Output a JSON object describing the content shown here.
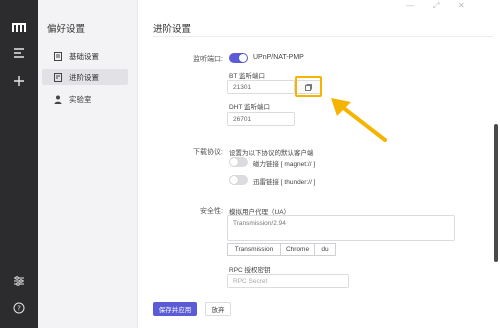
{
  "rail": {
    "logo_icon": "m-logo-icon",
    "items": [
      {
        "name": "menu-icon"
      },
      {
        "name": "plus-icon"
      }
    ],
    "bottom": [
      {
        "name": "sliders-icon"
      },
      {
        "name": "help-icon"
      }
    ]
  },
  "sidebar": {
    "title": "偏好设置",
    "items": [
      {
        "label": "基础设置",
        "icon": "basic-settings-icon"
      },
      {
        "label": "进阶设置",
        "icon": "advanced-settings-icon",
        "active": true
      },
      {
        "label": "实验室",
        "icon": "lab-icon"
      }
    ]
  },
  "main": {
    "title": "进阶设置",
    "listen_port": {
      "label": "监听端口:",
      "toggle_label": "UPnP/NAT-PMP",
      "toggle_on": true,
      "bt_label": "BT 监听端口",
      "bt_value": "21301",
      "dht_label": "DHT 监听端口",
      "dht_value": "26701"
    },
    "protocol": {
      "label": "下载协议:",
      "description": "设置为以下协议的默认客户端",
      "options": [
        {
          "label": "磁力链接 [ magnet:// ]",
          "on": false
        },
        {
          "label": "迅雷链接 [ thunder:// ]",
          "on": false
        }
      ]
    },
    "security": {
      "label": "安全性:",
      "ua_label": "模拟用户代理（UA）",
      "ua_value": "Transmission/2.94",
      "ua_buttons": [
        "Transmission",
        "Chrome",
        "du"
      ],
      "rpc_label": "RPC 授权密钥",
      "rpc_placeholder": "RPC Secret"
    },
    "buttons": {
      "save": "保存并应用",
      "discard": "放弃"
    }
  },
  "colors": {
    "accent": "#5b5bd6",
    "highlight": "#f5b400",
    "rail_bg": "#2c2c2e"
  }
}
